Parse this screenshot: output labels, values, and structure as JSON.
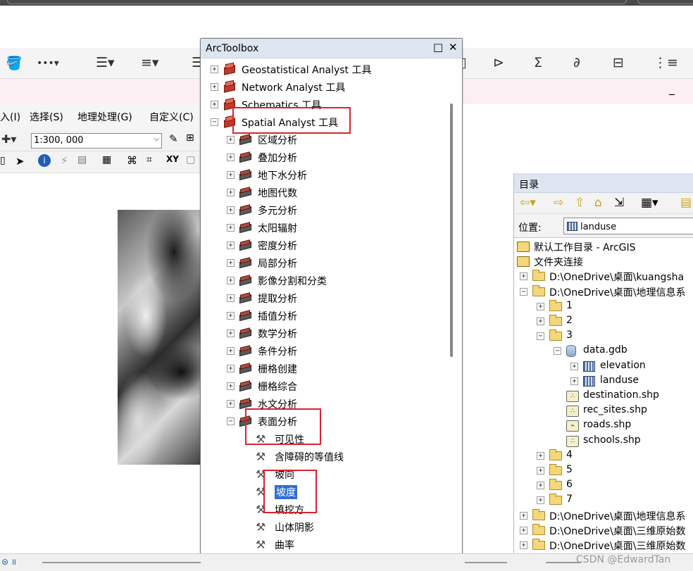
{
  "menu": {
    "insert": "入(I)",
    "select": "选择(S)",
    "geoprocessing": "地理处理(G)",
    "customize": "自定义(C)"
  },
  "toolbar": {
    "scale": "1:300, 000"
  },
  "arctoolbox": {
    "title": "ArcToolbox",
    "toolboxes": [
      {
        "label": "Geostatistical Analyst 工具",
        "expander": "+"
      },
      {
        "label": "Network Analyst 工具",
        "expander": "+"
      },
      {
        "label": "Schematics 工具",
        "expander": "+"
      },
      {
        "label": "Spatial Analyst 工具",
        "expander": "−"
      }
    ],
    "toolsets": [
      {
        "label": "区域分析",
        "expander": "+"
      },
      {
        "label": "叠加分析",
        "expander": "+"
      },
      {
        "label": "地下水分析",
        "expander": "+"
      },
      {
        "label": "地图代数",
        "expander": "+"
      },
      {
        "label": "多元分析",
        "expander": "+"
      },
      {
        "label": "太阳辐射",
        "expander": "+"
      },
      {
        "label": "密度分析",
        "expander": "+"
      },
      {
        "label": "局部分析",
        "expander": "+"
      },
      {
        "label": "影像分割和分类",
        "expander": "+"
      },
      {
        "label": "提取分析",
        "expander": "+"
      },
      {
        "label": "插值分析",
        "expander": "+"
      },
      {
        "label": "数学分析",
        "expander": "+"
      },
      {
        "label": "条件分析",
        "expander": "+"
      },
      {
        "label": "栅格创建",
        "expander": "+"
      },
      {
        "label": "栅格综合",
        "expander": "+"
      },
      {
        "label": "水文分析",
        "expander": "+"
      },
      {
        "label": "表面分析",
        "expander": "−"
      }
    ],
    "tools": [
      {
        "label": "可见性"
      },
      {
        "label": "含障碍的等值线"
      },
      {
        "label": "坡向"
      },
      {
        "label": "坡度",
        "selected": true
      },
      {
        "label": "填挖方"
      },
      {
        "label": "山体阴影"
      },
      {
        "label": "曲率"
      }
    ]
  },
  "catalog": {
    "title": "目录",
    "location_label": "位置:",
    "location_value": "landuse",
    "items": [
      {
        "label": "默认工作目录 - ArcGIS",
        "type": "home",
        "level": 0,
        "expander": ""
      },
      {
        "label": "文件夹连接",
        "type": "conn",
        "level": 0,
        "expander": ""
      },
      {
        "label": "D:\\OneDrive\\桌面\\kuangsha",
        "type": "folder",
        "level": 0,
        "expander": "+"
      },
      {
        "label": "D:\\OneDrive\\桌面\\地理信息系",
        "type": "folder",
        "level": 0,
        "expander": "−"
      },
      {
        "label": "1",
        "type": "folder",
        "level": 1,
        "expander": "+"
      },
      {
        "label": "2",
        "type": "folder",
        "level": 1,
        "expander": "+"
      },
      {
        "label": "3",
        "type": "folder",
        "level": 1,
        "expander": "−"
      },
      {
        "label": "data.gdb",
        "type": "gdb",
        "level": 2,
        "expander": "−"
      },
      {
        "label": "elevation",
        "type": "grid",
        "level": 3,
        "expander": "+"
      },
      {
        "label": "landuse",
        "type": "grid",
        "level": 3,
        "expander": "+"
      },
      {
        "label": "destination.shp",
        "type": "shp",
        "level": 2,
        "expander": ""
      },
      {
        "label": "rec_sites.shp",
        "type": "shp",
        "level": 2,
        "expander": ""
      },
      {
        "label": "roads.shp",
        "type": "shp",
        "level": 2,
        "expander": ""
      },
      {
        "label": "schools.shp",
        "type": "shp",
        "level": 2,
        "expander": ""
      },
      {
        "label": "4",
        "type": "folder",
        "level": 1,
        "expander": "+"
      },
      {
        "label": "5",
        "type": "folder",
        "level": 1,
        "expander": "+"
      },
      {
        "label": "6",
        "type": "folder",
        "level": 1,
        "expander": "+"
      },
      {
        "label": "7",
        "type": "folder",
        "level": 1,
        "expander": "+"
      },
      {
        "label": "D:\\OneDrive\\桌面\\地理信息系",
        "type": "folder",
        "level": 0,
        "expander": "+"
      },
      {
        "label": "D:\\OneDrive\\桌面\\三维原始数",
        "type": "folder",
        "level": 0,
        "expander": "+"
      },
      {
        "label": "D:\\OneDrive\\桌面\\三维原始数",
        "type": "folder",
        "level": 0,
        "expander": "+"
      }
    ]
  },
  "watermark": "CSDN @EdwardTan",
  "colors": {
    "highlight_box": "#d9232d",
    "selection": "#2f6fd0",
    "panel_title": "#dde5f0"
  }
}
